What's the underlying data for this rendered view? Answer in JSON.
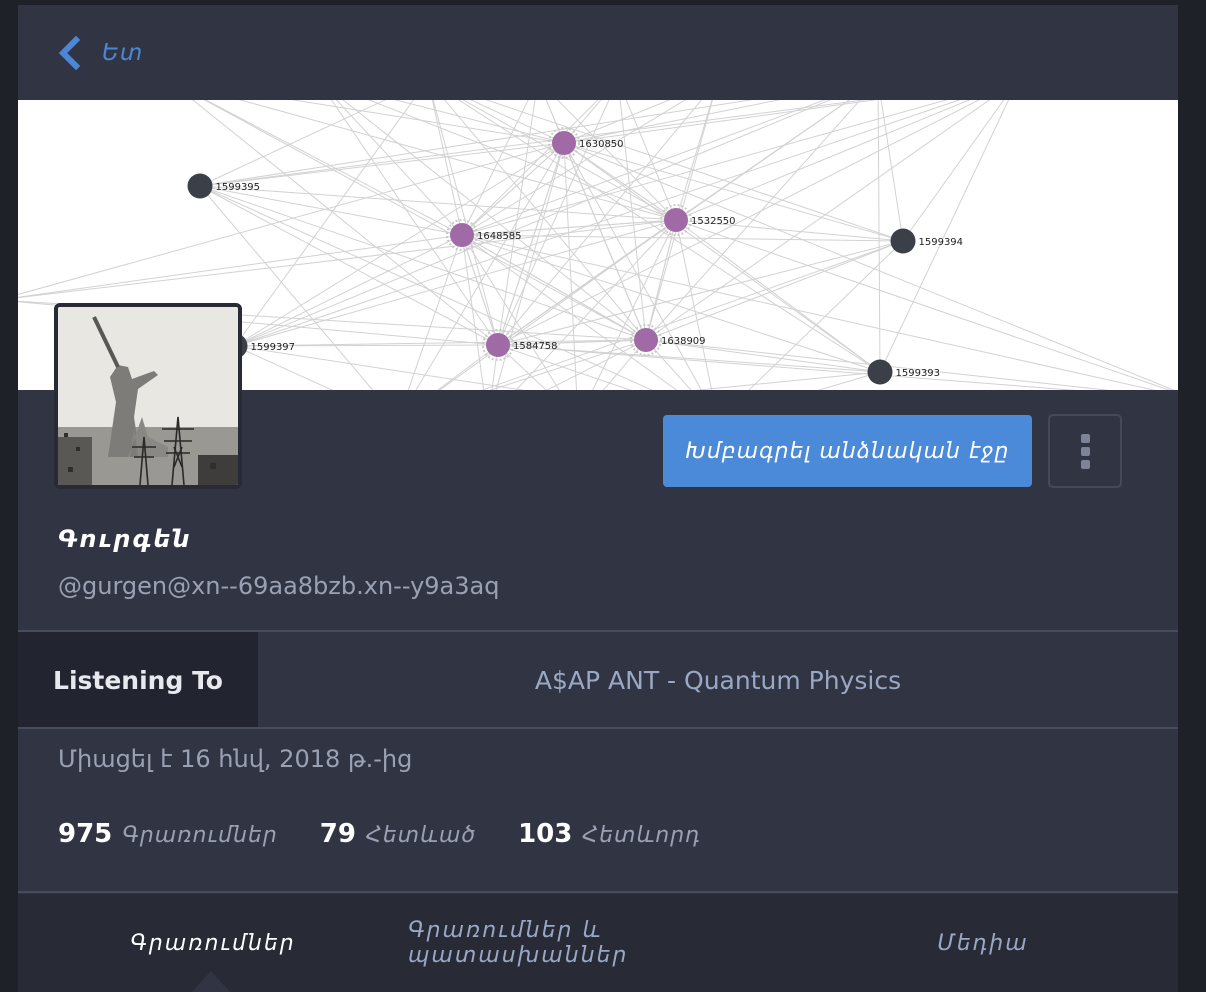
{
  "nav": {
    "back_label": "Ետ"
  },
  "header_graph": {
    "nodes": [
      {
        "label": "1630850",
        "kind": "hub"
      },
      {
        "label": "1599395",
        "kind": "leaf"
      },
      {
        "label": "1648585",
        "kind": "hub"
      },
      {
        "label": "1532550",
        "kind": "hub"
      },
      {
        "label": "1599394",
        "kind": "leaf"
      },
      {
        "label": "1599397",
        "kind": "leaf"
      },
      {
        "label": "1584758",
        "kind": "hub"
      },
      {
        "label": "1638909",
        "kind": "hub"
      },
      {
        "label": "1599393",
        "kind": "leaf"
      }
    ],
    "colors": {
      "hub": "#a06aa6",
      "leaf": "#3b4048",
      "edge": "#d2d2d2"
    }
  },
  "profile": {
    "display_name": "Գուրգեն",
    "handle": "@gurgen@xn--69aa8bzb.xn--y9a3aq",
    "edit_button_label": "Խմբագրել անձնական էջը",
    "menu_icon": "vertical-ellipsis-icon"
  },
  "fields": [
    {
      "name": "Listening To",
      "value": "A$AP ANT - Quantum Physics"
    }
  ],
  "joined": "Միացել է 16 հնվ, 2018 թ.-ից",
  "counts": [
    {
      "value": "975",
      "label": "Գրառումներ"
    },
    {
      "value": "79",
      "label": "Հետևած"
    },
    {
      "value": "103",
      "label": "Հետևորդ"
    }
  ],
  "tabs": [
    {
      "label": "Գրառումներ",
      "active": true
    },
    {
      "label": "Գրառումներ և պատասխաններ",
      "active": false
    },
    {
      "label": "Մեդիա",
      "active": false
    }
  ],
  "theme": {
    "accent": "#4b8ad8",
    "background": "#313543"
  }
}
